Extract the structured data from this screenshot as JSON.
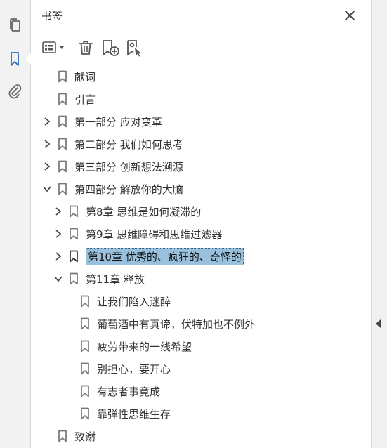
{
  "panel": {
    "title": "书签"
  },
  "icons": {
    "rail": [
      "pages-icon",
      "bookmark-icon",
      "attachment-icon"
    ],
    "toolbar": [
      "options-menu-icon",
      "delete-icon",
      "new-bookmark-icon",
      "bookmark-from-structure-icon"
    ],
    "close": "close-icon"
  },
  "colors": {
    "selection": "#99c1de",
    "active_rail_icon": "#2d6db5"
  },
  "tree": [
    {
      "label": "献词",
      "level": 0,
      "expander": "none",
      "selected": false
    },
    {
      "label": "引言",
      "level": 0,
      "expander": "none",
      "selected": false
    },
    {
      "label": "第一部分 应对变革",
      "level": 0,
      "expander": "collapsed",
      "selected": false
    },
    {
      "label": "第二部分 我们如何思考",
      "level": 0,
      "expander": "collapsed",
      "selected": false
    },
    {
      "label": "第三部分 创新想法溯源",
      "level": 0,
      "expander": "collapsed",
      "selected": false
    },
    {
      "label": "第四部分 解放你的大脑",
      "level": 0,
      "expander": "expanded",
      "selected": false
    },
    {
      "label": "第8章 思维是如何凝滞的",
      "level": 1,
      "expander": "collapsed",
      "selected": false
    },
    {
      "label": "第9章 思维障碍和思维过滤器",
      "level": 1,
      "expander": "collapsed",
      "selected": false
    },
    {
      "label": "第10章 优秀的、疯狂的、奇怪的",
      "level": 1,
      "expander": "collapsed",
      "selected": true
    },
    {
      "label": "第11章 释放",
      "level": 1,
      "expander": "expanded",
      "selected": false
    },
    {
      "label": "让我们陷入迷醉",
      "level": 2,
      "expander": "none",
      "selected": false
    },
    {
      "label": "葡萄酒中有真谛，伏特加也不例外",
      "level": 2,
      "expander": "none",
      "selected": false
    },
    {
      "label": "疲劳带来的一线希望",
      "level": 2,
      "expander": "none",
      "selected": false
    },
    {
      "label": "别担心，要开心",
      "level": 2,
      "expander": "none",
      "selected": false
    },
    {
      "label": "有志者事竟成",
      "level": 2,
      "expander": "none",
      "selected": false
    },
    {
      "label": "靠弹性思维生存",
      "level": 2,
      "expander": "none",
      "selected": false
    },
    {
      "label": "致谢",
      "level": 0,
      "expander": "none",
      "selected": false
    }
  ]
}
